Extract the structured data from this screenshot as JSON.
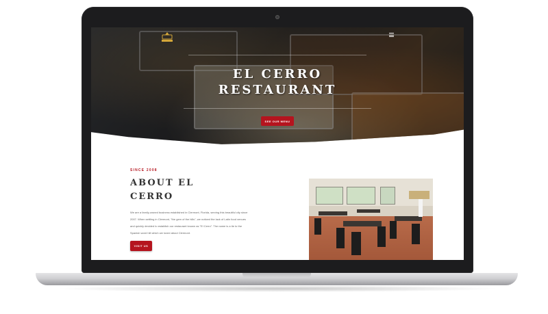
{
  "header": {
    "logo_icon": "el-cerro-logo-icon",
    "menu_icon": "hamburger-menu-icon"
  },
  "hero": {
    "title_line1": "EL CERRO",
    "title_line2": "RESTAURANT",
    "button_label": "SEE OUR MENU"
  },
  "about": {
    "since": "SINCE 2008",
    "title_line1": "ABOUT EL",
    "title_line2": "CERRO",
    "body": "We are a family-owned business established in Clermont, Florida, serving this beautiful city since 2007. When settling in Clermont, \"the gem of the hills\", we noticed the lack of Latin food venues and quickly decided to establish our restaurant known as \"El Cerro\". The name is a tie to the Spanish word hill which we loved about Clermont.",
    "button_label": "VISIT US"
  },
  "colors": {
    "accent": "#b5141e",
    "laptop_frame": "#1c1c1e"
  }
}
